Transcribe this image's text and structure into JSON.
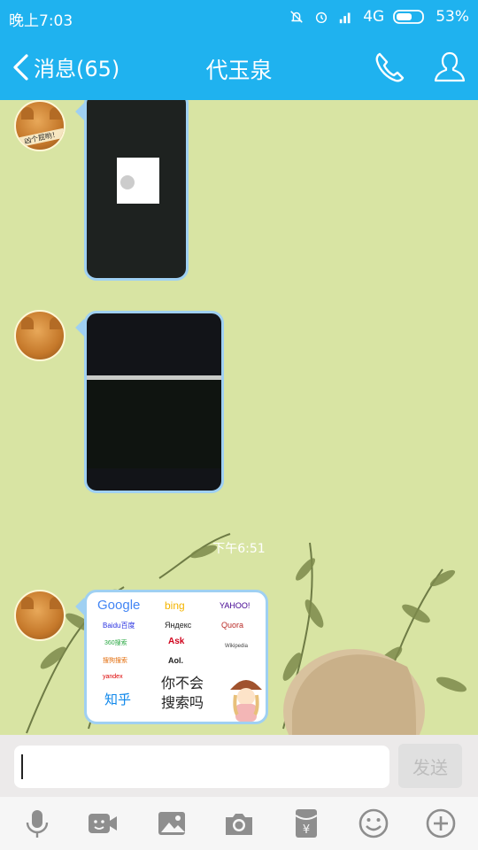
{
  "status": {
    "time": "晚上7:03",
    "network": "4G",
    "battery": "53%"
  },
  "nav": {
    "back_label": "消息(65)",
    "title": "代玉泉"
  },
  "chat": {
    "avatar_caption": "凶个屁哟！",
    "timestamp": "下午6:51",
    "search_card": {
      "logos": [
        "Google",
        "bing",
        "YAHOO!",
        "Baidu百度",
        "Яндекс",
        "Quora",
        "360搜索",
        "Ask",
        "Wikipedia",
        "搜狗搜索",
        "Aol.",
        "yandex",
        "知乎"
      ],
      "text_line1": "你不会",
      "text_line2": "搜索吗"
    }
  },
  "composer": {
    "send_label": "发送"
  },
  "colors": {
    "header": "#1fb2ef",
    "chat_bg": "#d8e4a3",
    "bubble_border": "#9fd0f2"
  },
  "toolbar": {
    "icons": [
      "mic-icon",
      "video-icon",
      "image-icon",
      "camera-icon",
      "red-packet-icon",
      "emoji-icon",
      "plus-icon"
    ]
  }
}
